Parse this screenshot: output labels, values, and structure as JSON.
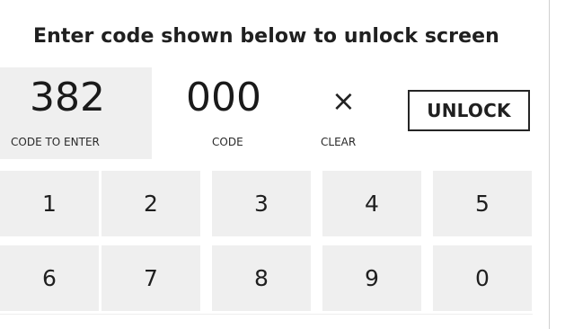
{
  "instruction": "Enter code shown below to unlock screen",
  "target": {
    "code": "382",
    "label": "CODE TO ENTER"
  },
  "entered": {
    "code": "000",
    "label": "CODE"
  },
  "clear": {
    "icon": "close-icon",
    "symbol": "×",
    "label": "CLEAR"
  },
  "unlock": {
    "label": "UNLOCK"
  },
  "keypad": {
    "keys": [
      "1",
      "2",
      "3",
      "4",
      "5",
      "6",
      "7",
      "8",
      "9",
      "0"
    ]
  },
  "colors": {
    "key_background": "#efefef",
    "button_border": "#252525"
  }
}
